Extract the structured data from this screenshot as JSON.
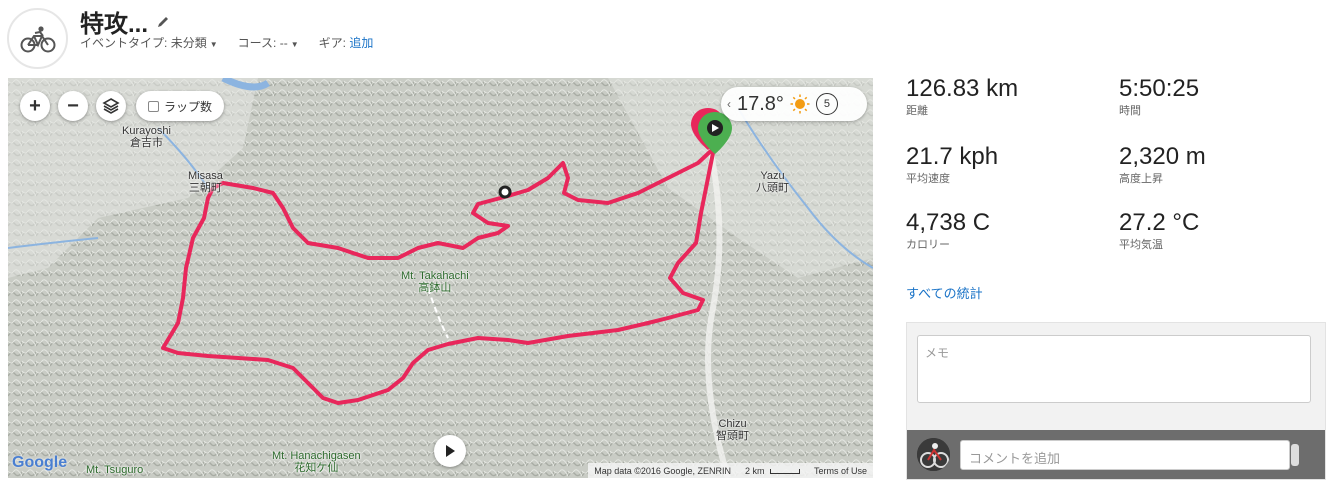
{
  "header": {
    "title": "特攻...",
    "event_type": {
      "label": "イベントタイプ:",
      "value": "未分類"
    },
    "course": {
      "label": "コース:",
      "value": "--"
    },
    "gear": {
      "label": "ギア:",
      "link": "追加"
    }
  },
  "map": {
    "lap_toggle": "ラップ数",
    "weather": {
      "temp": "17.8°",
      "wind": "5"
    },
    "labels": {
      "kurayoshi_en": "Kurayoshi",
      "kurayoshi_jp": "倉吉市",
      "misasa_en": "Misasa",
      "misasa_jp": "三朝町",
      "yazu_en": "Yazu",
      "yazu_jp": "八頭町",
      "takahachi_en": "Mt. Takahachi",
      "takahachi_jp": "高鉢山",
      "chizu_en": "Chizu",
      "chizu_jp": "智頭町",
      "hanachigasen_en": "Mt. Hanachigasen",
      "hanachigasen_jp": "花知ケ仙",
      "tsuguro_en": "Mt. Tsuguro"
    },
    "google": "Google",
    "attribution": "Map data ©2016 Google, ZENRIN",
    "scale": "2 km",
    "terms": "Terms of Use",
    "route_color": "#e8275b",
    "start_color": "#4caf50",
    "end_color": "#e8275b"
  },
  "stats": {
    "distance": {
      "value": "126.83 km",
      "label": "距離"
    },
    "time": {
      "value": "5:50:25",
      "label": "時間"
    },
    "avg_speed": {
      "value": "21.7 kph",
      "label": "平均速度"
    },
    "elevation": {
      "value": "2,320 m",
      "label": "高度上昇"
    },
    "calories": {
      "value": "4,738 C",
      "label": "カロリー"
    },
    "avg_temp": {
      "value": "27.2 °C",
      "label": "平均気温"
    },
    "all_stats_link": "すべての統計"
  },
  "comments": {
    "memo_placeholder": "メモ",
    "comment_placeholder": "コメントを追加"
  }
}
